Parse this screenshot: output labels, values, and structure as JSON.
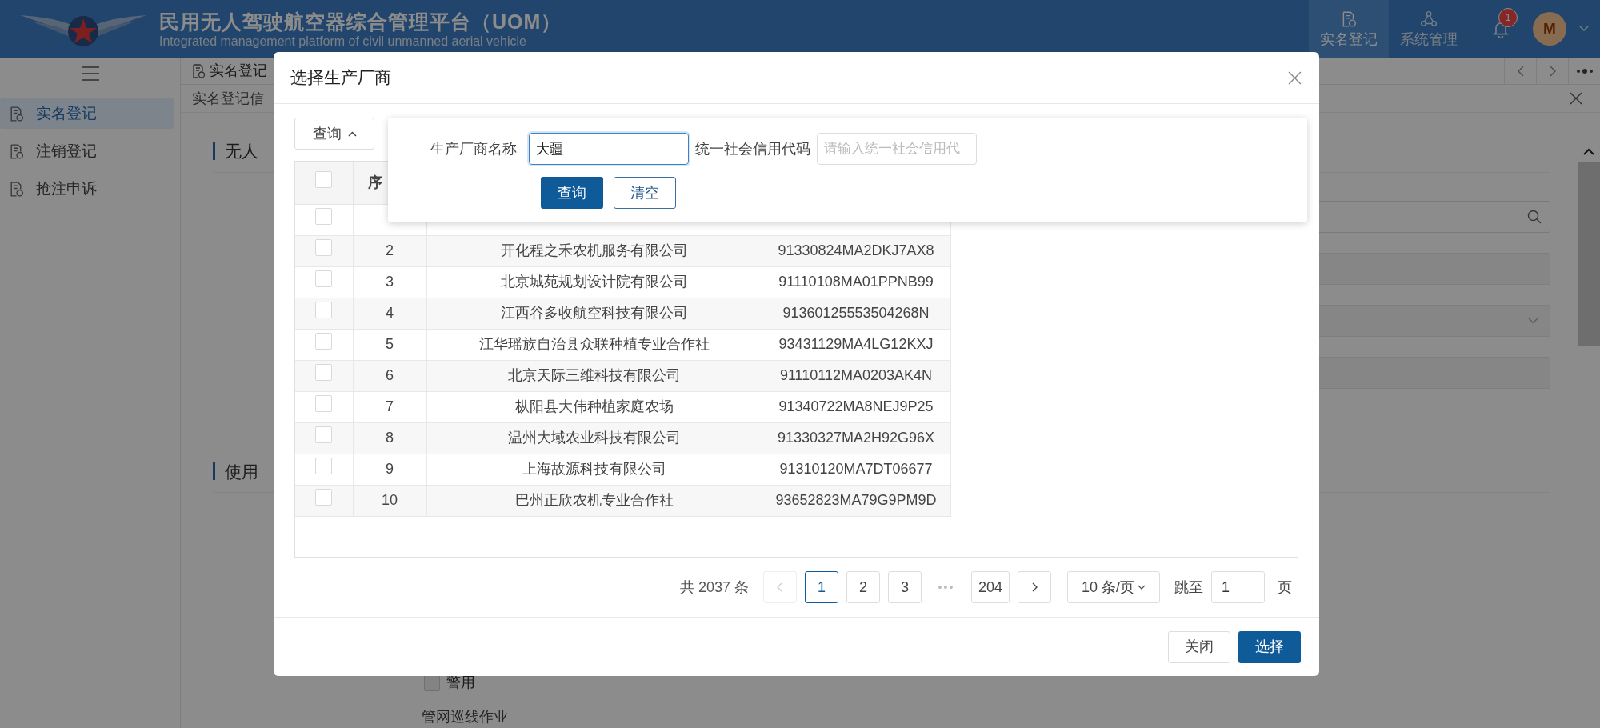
{
  "header": {
    "title": "民用无人驾驶航空器综合管理平台（UOM）",
    "subtitle": "Integrated management platform of civil unmanned aerial vehicle",
    "nav": [
      {
        "label": "实名登记",
        "selected": true
      },
      {
        "label": "系统管理",
        "selected": false
      }
    ],
    "notification_count": "1",
    "avatar": "M"
  },
  "sidebar": {
    "items": [
      {
        "label": "实名登记",
        "selected": true
      },
      {
        "label": "注销登记",
        "selected": false
      },
      {
        "label": "抢注申诉",
        "selected": false
      }
    ]
  },
  "tabs": [
    {
      "label": "实名登记",
      "selected": true
    }
  ],
  "breadcrumb": "实名登记信",
  "background": {
    "sections": [
      "无人",
      "使用"
    ],
    "checkbox": {
      "label": "警用",
      "checked": false
    },
    "text": "管网巡线作业"
  },
  "modal": {
    "title": "选择生产厂商",
    "query_toggle": {
      "label": "查询",
      "expanded": true
    },
    "filter": {
      "fields": [
        {
          "label": "生产厂商名称",
          "value": "大疆",
          "focused": true
        },
        {
          "label": "统一社会信用代码",
          "placeholder": "请输入统一社会信用代",
          "focused": false
        }
      ],
      "buttons": [
        {
          "label": "查询",
          "kind": "primary"
        },
        {
          "label": "清空",
          "kind": "default"
        }
      ]
    },
    "table": {
      "header": {
        "checked": false,
        "index_label": "序"
      },
      "rows": [
        {
          "selected": false
        },
        {
          "selected": false,
          "index": "2",
          "name": "开化程之禾农机服务有限公司",
          "code": "91330824MA2DKJ7AX8"
        },
        {
          "selected": false,
          "index": "3",
          "name": "北京城苑规划设计院有限公司",
          "code": "91110108MA01PPNB99"
        },
        {
          "selected": false,
          "index": "4",
          "name": "江西谷多收航空科技有限公司",
          "code": "91360125553504268N"
        },
        {
          "selected": false,
          "index": "5",
          "name": "江华瑶族自治县众联种植专业合作社",
          "code": "93431129MA4LG12KXJ"
        },
        {
          "selected": false,
          "index": "6",
          "name": "北京天际三维科技有限公司",
          "code": "91110112MA0203AK4N"
        },
        {
          "selected": false,
          "index": "7",
          "name": "枞阳县大伟种植家庭农场",
          "code": "91340722MA8NEJ9P25"
        },
        {
          "selected": false,
          "index": "8",
          "name": "温州大域农业科技有限公司",
          "code": "91330327MA2H92G96X"
        },
        {
          "selected": false,
          "index": "9",
          "name": "上海故源科技有限公司",
          "code": "91310120MA7DT06677"
        },
        {
          "selected": false,
          "index": "10",
          "name": "巴州正欣农机专业合作社",
          "code": "93652823MA79G9PM9D"
        }
      ]
    },
    "pagination": {
      "total": "共 2037 条",
      "prev_disabled": true,
      "next_disabled": false,
      "pages": [
        {
          "label": "1",
          "kind": "page",
          "selected": true
        },
        {
          "label": "2",
          "kind": "page",
          "selected": false
        },
        {
          "label": "3",
          "kind": "page",
          "selected": false
        },
        {
          "label": "•••",
          "kind": "ellipsis",
          "selected": false
        },
        {
          "label": "204",
          "kind": "page",
          "selected": false
        }
      ],
      "page_size": "10 条/页",
      "jump_label": "跳至",
      "jump_value": "1",
      "page_suffix": "页"
    },
    "buttons": [
      {
        "label": "关闭",
        "kind": "default"
      },
      {
        "label": "选择",
        "kind": "primary"
      }
    ]
  }
}
